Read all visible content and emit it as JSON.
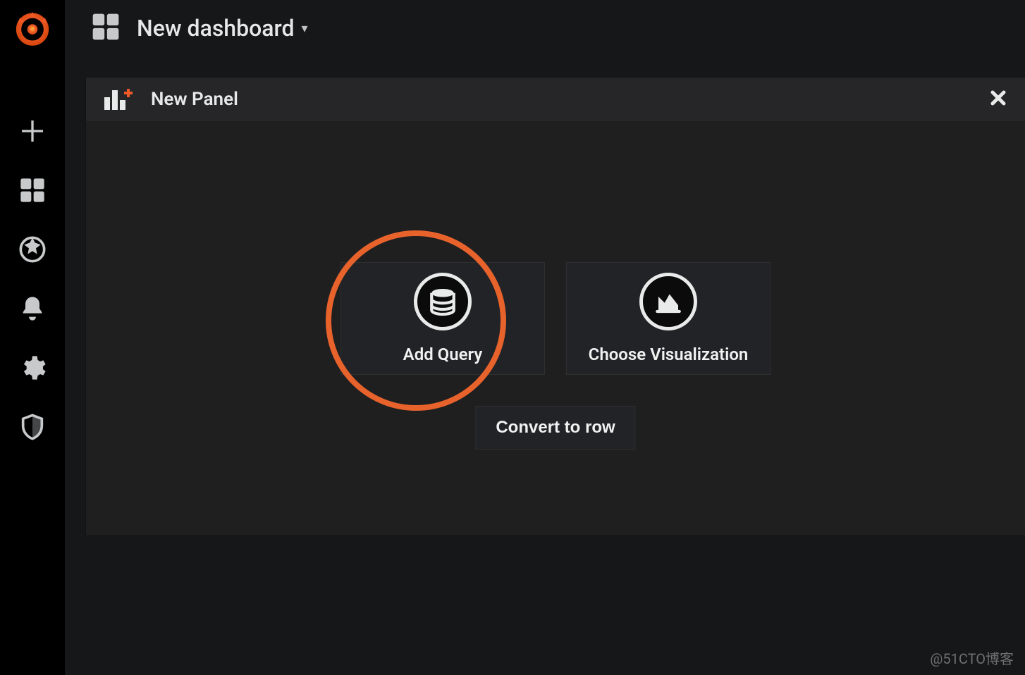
{
  "header": {
    "title": "New dashboard"
  },
  "panel": {
    "title": "New Panel",
    "actions": {
      "add_query": "Add Query",
      "choose_visualization": "Choose Visualization",
      "convert_to_row": "Convert to row"
    }
  },
  "sidebar": {
    "items": [
      {
        "name": "create",
        "icon": "plus-icon"
      },
      {
        "name": "dashboards",
        "icon": "apps-icon"
      },
      {
        "name": "explore",
        "icon": "compass-icon"
      },
      {
        "name": "alerting",
        "icon": "bell-icon"
      },
      {
        "name": "configuration",
        "icon": "gear-icon"
      },
      {
        "name": "server-admin",
        "icon": "shield-icon"
      }
    ]
  },
  "watermark": "@51CTO博客",
  "annotation": {
    "highlighted_action": "add_query"
  }
}
